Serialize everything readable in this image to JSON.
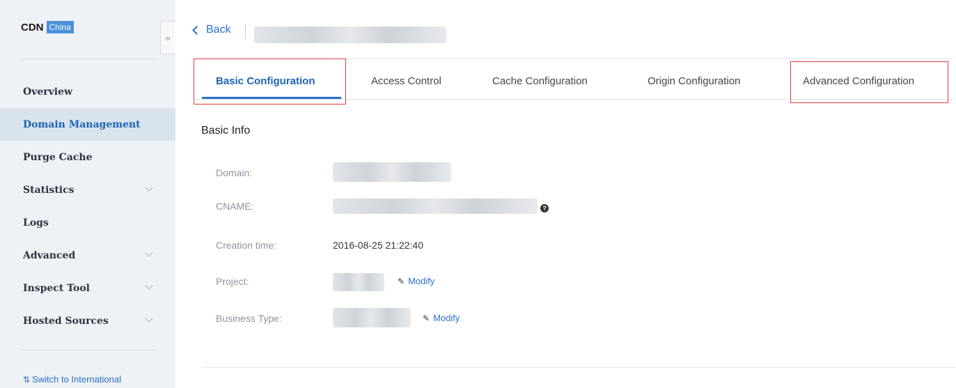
{
  "sidebar": {
    "brand": "CDN",
    "badge": "China",
    "collapse_icon": "«",
    "items": [
      {
        "label": "Overview",
        "active": false,
        "expandable": false
      },
      {
        "label": "Domain Management",
        "active": true,
        "expandable": false
      },
      {
        "label": "Purge Cache",
        "active": false,
        "expandable": false
      },
      {
        "label": "Statistics",
        "active": false,
        "expandable": true
      },
      {
        "label": "Logs",
        "active": false,
        "expandable": false
      },
      {
        "label": "Advanced",
        "active": false,
        "expandable": true
      },
      {
        "label": "Inspect Tool",
        "active": false,
        "expandable": true
      },
      {
        "label": "Hosted Sources",
        "active": false,
        "expandable": true
      }
    ],
    "switch_label": "Switch to International",
    "switch_icon": "switch-icon"
  },
  "header": {
    "back_label": "Back"
  },
  "tabs": [
    {
      "label": "Basic Configuration",
      "active": true
    },
    {
      "label": "Access Control",
      "active": false
    },
    {
      "label": "Cache Configuration",
      "active": false
    },
    {
      "label": "Origin Configuration",
      "active": false
    },
    {
      "label": "Advanced Configuration",
      "active": false
    }
  ],
  "basic_info": {
    "title": "Basic Info",
    "domain_label": "Domain:",
    "cname_label": "CNAME:",
    "creation_label": "Creation time:",
    "creation_value": "2016-08-25 21:22:40",
    "project_label": "Project:",
    "business_label": "Business Type:",
    "modify_label": "Modify",
    "help_glyph": "?"
  },
  "colors": {
    "accent": "#2a6fc9",
    "highlight_box": "#e33b3b",
    "sidebar_bg": "#eef1f5",
    "sidebar_active_bg": "#d9e3ee",
    "badge_bg": "#4a90d9"
  }
}
